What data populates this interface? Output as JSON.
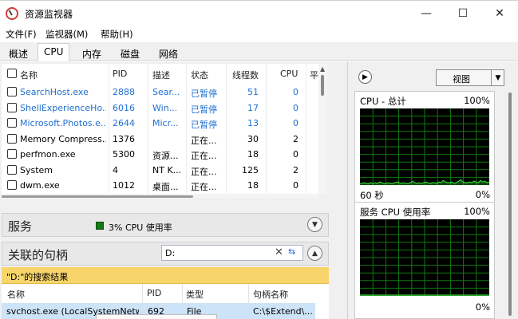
{
  "window": {
    "title": "资源监视器",
    "minimize": "—",
    "maximize": "☐",
    "close": "✕"
  },
  "menu": [
    "文件(F)",
    "监视器(M)",
    "帮助(H)"
  ],
  "tabs": [
    "概述",
    "CPU",
    "内存",
    "磁盘",
    "网络"
  ],
  "active_tab": "CPU",
  "process_table": {
    "headers": [
      "名称",
      "PID",
      "描述",
      "状态",
      "线程数",
      "CPU",
      "平"
    ],
    "rows": [
      {
        "name": "SearchHost.exe",
        "pid": "2888",
        "desc": "Sear...",
        "status": "已暂停",
        "threads": "51",
        "cpu": "0",
        "suspended": true
      },
      {
        "name": "ShellExperienceHo...",
        "pid": "6016",
        "desc": "Win...",
        "status": "已暂停",
        "threads": "17",
        "cpu": "0",
        "suspended": true
      },
      {
        "name": "Microsoft.Photos.e...",
        "pid": "2644",
        "desc": "Micr...",
        "status": "已暂停",
        "threads": "13",
        "cpu": "0",
        "suspended": true
      },
      {
        "name": "Memory Compress...",
        "pid": "1376",
        "desc": "",
        "status": "正在...",
        "threads": "30",
        "cpu": "2",
        "suspended": false
      },
      {
        "name": "perfmon.exe",
        "pid": "5300",
        "desc": "资源...",
        "status": "正在...",
        "threads": "18",
        "cpu": "0",
        "suspended": false
      },
      {
        "name": "System",
        "pid": "4",
        "desc": "NT K...",
        "status": "正在...",
        "threads": "125",
        "cpu": "2",
        "suspended": false
      },
      {
        "name": "dwm.exe",
        "pid": "1012",
        "desc": "桌面...",
        "status": "正在...",
        "threads": "18",
        "cpu": "0",
        "suspended": false
      }
    ]
  },
  "services": {
    "title": "服务",
    "cpu_usage": "3% CPU 使用率"
  },
  "handles": {
    "title": "关联的句柄",
    "search_value": "D:",
    "results_label": "\"D:\"的搜索结果",
    "headers": [
      "名称",
      "PID",
      "类型",
      "句柄名称"
    ],
    "row": {
      "name": "svchost.exe (LocalSystemNetw...",
      "pid": "692",
      "type": "File",
      "handle": "C:\\$Extend\\..."
    }
  },
  "right_panel": {
    "view_label": "视图",
    "graphs": [
      {
        "title": "CPU - 总计",
        "top": "100%",
        "foot_left": "60 秒",
        "foot_right": "0%"
      },
      {
        "title": "服务 CPU 使用率",
        "top": "100%",
        "foot_left": "",
        "foot_right": "0%"
      }
    ]
  },
  "colors": {
    "suspended_text": "#1f6fd0",
    "graph_bg": "#000000",
    "graph_grid": "#0f7a0f",
    "graph_line": "#34d034",
    "banner": "#f8d56b"
  },
  "chart_data": [
    {
      "type": "area",
      "title": "CPU - 总计",
      "ylim": [
        0,
        100
      ],
      "y_unit": "%",
      "x_span": "60 秒",
      "values": [
        1,
        1,
        2,
        1,
        1,
        2,
        1,
        2,
        1,
        3,
        2,
        1,
        1,
        2,
        1,
        1,
        2,
        3,
        2,
        1,
        2,
        1,
        1,
        2,
        4,
        2,
        1,
        2,
        1,
        2,
        3,
        2,
        1,
        2,
        2,
        1,
        3,
        2,
        5,
        3,
        2,
        2,
        3,
        1,
        2,
        4,
        6,
        3,
        2,
        2,
        3,
        2,
        4,
        3,
        2,
        5,
        3,
        4,
        2,
        3
      ]
    },
    {
      "type": "area",
      "title": "服务 CPU 使用率",
      "ylim": [
        0,
        100
      ],
      "y_unit": "%",
      "values": [
        0,
        0,
        0,
        0,
        0,
        0,
        0,
        0,
        0,
        0,
        0,
        0,
        0,
        0,
        0,
        0,
        0,
        0,
        0,
        0
      ]
    }
  ]
}
